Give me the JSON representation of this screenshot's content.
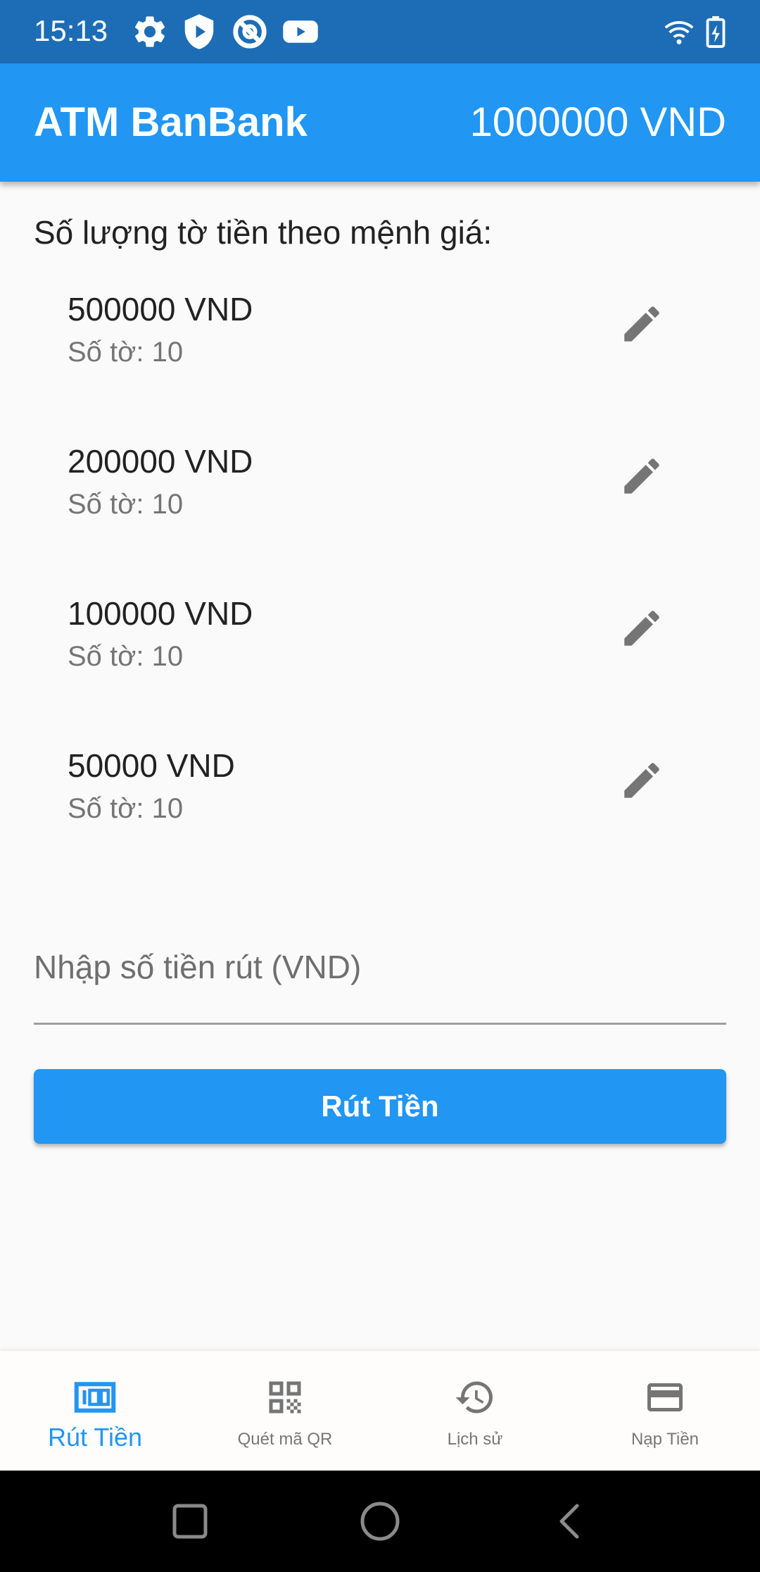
{
  "status_bar": {
    "time": "15:13",
    "icons": [
      "gear-icon",
      "shield-icon",
      "no-entry-icon",
      "youtube-icon"
    ],
    "right_icons": [
      "wifi-icon",
      "battery-icon"
    ]
  },
  "app_bar": {
    "title": "ATM BanBank",
    "balance": "1000000 VND"
  },
  "section_heading": "Số lượng tờ tiền theo mệnh giá:",
  "denominations": [
    {
      "value": "500000 VND",
      "count": "Số tờ: 10"
    },
    {
      "value": "200000 VND",
      "count": "Số tờ: 10"
    },
    {
      "value": "100000 VND",
      "count": "Số tờ: 10"
    },
    {
      "value": "50000 VND",
      "count": "Số tờ: 10"
    }
  ],
  "amount_field": {
    "placeholder": "Nhập số tiền rút (VND)",
    "value": ""
  },
  "withdraw_button": "Rút Tiền",
  "bottom_nav": [
    {
      "label": "Rút Tiền",
      "icon": "money-icon",
      "active": true
    },
    {
      "label": "Quét mã QR",
      "icon": "qr-code-icon",
      "active": false
    },
    {
      "label": "Lịch sử",
      "icon": "history-icon",
      "active": false
    },
    {
      "label": "Nạp Tiền",
      "icon": "credit-card-icon",
      "active": false
    }
  ],
  "colors": {
    "primary": "#2196f3",
    "status_bar": "#1c6db6",
    "icon_gray": "#757575"
  }
}
